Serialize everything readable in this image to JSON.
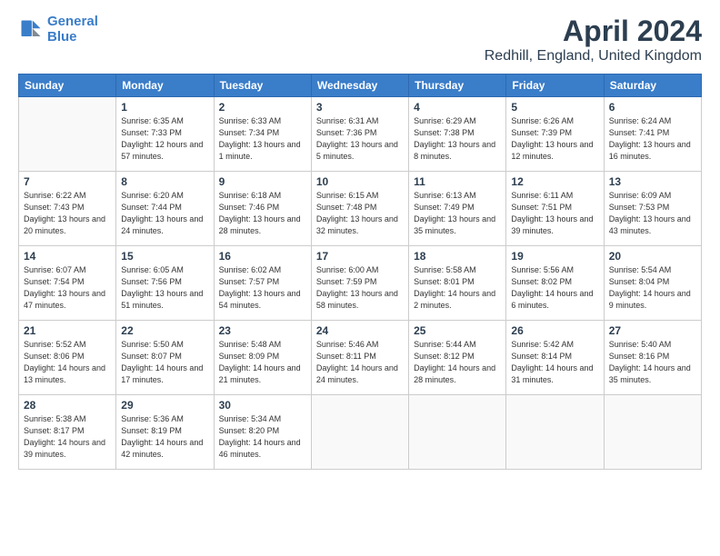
{
  "header": {
    "logo_line1": "General",
    "logo_line2": "Blue",
    "title": "April 2024",
    "subtitle": "Redhill, England, United Kingdom"
  },
  "days_of_week": [
    "Sunday",
    "Monday",
    "Tuesday",
    "Wednesday",
    "Thursday",
    "Friday",
    "Saturday"
  ],
  "weeks": [
    [
      {
        "num": "",
        "sunrise": "",
        "sunset": "",
        "daylight": ""
      },
      {
        "num": "1",
        "sunrise": "Sunrise: 6:35 AM",
        "sunset": "Sunset: 7:33 PM",
        "daylight": "Daylight: 12 hours and 57 minutes."
      },
      {
        "num": "2",
        "sunrise": "Sunrise: 6:33 AM",
        "sunset": "Sunset: 7:34 PM",
        "daylight": "Daylight: 13 hours and 1 minute."
      },
      {
        "num": "3",
        "sunrise": "Sunrise: 6:31 AM",
        "sunset": "Sunset: 7:36 PM",
        "daylight": "Daylight: 13 hours and 5 minutes."
      },
      {
        "num": "4",
        "sunrise": "Sunrise: 6:29 AM",
        "sunset": "Sunset: 7:38 PM",
        "daylight": "Daylight: 13 hours and 8 minutes."
      },
      {
        "num": "5",
        "sunrise": "Sunrise: 6:26 AM",
        "sunset": "Sunset: 7:39 PM",
        "daylight": "Daylight: 13 hours and 12 minutes."
      },
      {
        "num": "6",
        "sunrise": "Sunrise: 6:24 AM",
        "sunset": "Sunset: 7:41 PM",
        "daylight": "Daylight: 13 hours and 16 minutes."
      }
    ],
    [
      {
        "num": "7",
        "sunrise": "Sunrise: 6:22 AM",
        "sunset": "Sunset: 7:43 PM",
        "daylight": "Daylight: 13 hours and 20 minutes."
      },
      {
        "num": "8",
        "sunrise": "Sunrise: 6:20 AM",
        "sunset": "Sunset: 7:44 PM",
        "daylight": "Daylight: 13 hours and 24 minutes."
      },
      {
        "num": "9",
        "sunrise": "Sunrise: 6:18 AM",
        "sunset": "Sunset: 7:46 PM",
        "daylight": "Daylight: 13 hours and 28 minutes."
      },
      {
        "num": "10",
        "sunrise": "Sunrise: 6:15 AM",
        "sunset": "Sunset: 7:48 PM",
        "daylight": "Daylight: 13 hours and 32 minutes."
      },
      {
        "num": "11",
        "sunrise": "Sunrise: 6:13 AM",
        "sunset": "Sunset: 7:49 PM",
        "daylight": "Daylight: 13 hours and 35 minutes."
      },
      {
        "num": "12",
        "sunrise": "Sunrise: 6:11 AM",
        "sunset": "Sunset: 7:51 PM",
        "daylight": "Daylight: 13 hours and 39 minutes."
      },
      {
        "num": "13",
        "sunrise": "Sunrise: 6:09 AM",
        "sunset": "Sunset: 7:53 PM",
        "daylight": "Daylight: 13 hours and 43 minutes."
      }
    ],
    [
      {
        "num": "14",
        "sunrise": "Sunrise: 6:07 AM",
        "sunset": "Sunset: 7:54 PM",
        "daylight": "Daylight: 13 hours and 47 minutes."
      },
      {
        "num": "15",
        "sunrise": "Sunrise: 6:05 AM",
        "sunset": "Sunset: 7:56 PM",
        "daylight": "Daylight: 13 hours and 51 minutes."
      },
      {
        "num": "16",
        "sunrise": "Sunrise: 6:02 AM",
        "sunset": "Sunset: 7:57 PM",
        "daylight": "Daylight: 13 hours and 54 minutes."
      },
      {
        "num": "17",
        "sunrise": "Sunrise: 6:00 AM",
        "sunset": "Sunset: 7:59 PM",
        "daylight": "Daylight: 13 hours and 58 minutes."
      },
      {
        "num": "18",
        "sunrise": "Sunrise: 5:58 AM",
        "sunset": "Sunset: 8:01 PM",
        "daylight": "Daylight: 14 hours and 2 minutes."
      },
      {
        "num": "19",
        "sunrise": "Sunrise: 5:56 AM",
        "sunset": "Sunset: 8:02 PM",
        "daylight": "Daylight: 14 hours and 6 minutes."
      },
      {
        "num": "20",
        "sunrise": "Sunrise: 5:54 AM",
        "sunset": "Sunset: 8:04 PM",
        "daylight": "Daylight: 14 hours and 9 minutes."
      }
    ],
    [
      {
        "num": "21",
        "sunrise": "Sunrise: 5:52 AM",
        "sunset": "Sunset: 8:06 PM",
        "daylight": "Daylight: 14 hours and 13 minutes."
      },
      {
        "num": "22",
        "sunrise": "Sunrise: 5:50 AM",
        "sunset": "Sunset: 8:07 PM",
        "daylight": "Daylight: 14 hours and 17 minutes."
      },
      {
        "num": "23",
        "sunrise": "Sunrise: 5:48 AM",
        "sunset": "Sunset: 8:09 PM",
        "daylight": "Daylight: 14 hours and 21 minutes."
      },
      {
        "num": "24",
        "sunrise": "Sunrise: 5:46 AM",
        "sunset": "Sunset: 8:11 PM",
        "daylight": "Daylight: 14 hours and 24 minutes."
      },
      {
        "num": "25",
        "sunrise": "Sunrise: 5:44 AM",
        "sunset": "Sunset: 8:12 PM",
        "daylight": "Daylight: 14 hours and 28 minutes."
      },
      {
        "num": "26",
        "sunrise": "Sunrise: 5:42 AM",
        "sunset": "Sunset: 8:14 PM",
        "daylight": "Daylight: 14 hours and 31 minutes."
      },
      {
        "num": "27",
        "sunrise": "Sunrise: 5:40 AM",
        "sunset": "Sunset: 8:16 PM",
        "daylight": "Daylight: 14 hours and 35 minutes."
      }
    ],
    [
      {
        "num": "28",
        "sunrise": "Sunrise: 5:38 AM",
        "sunset": "Sunset: 8:17 PM",
        "daylight": "Daylight: 14 hours and 39 minutes."
      },
      {
        "num": "29",
        "sunrise": "Sunrise: 5:36 AM",
        "sunset": "Sunset: 8:19 PM",
        "daylight": "Daylight: 14 hours and 42 minutes."
      },
      {
        "num": "30",
        "sunrise": "Sunrise: 5:34 AM",
        "sunset": "Sunset: 8:20 PM",
        "daylight": "Daylight: 14 hours and 46 minutes."
      },
      {
        "num": "",
        "sunrise": "",
        "sunset": "",
        "daylight": ""
      },
      {
        "num": "",
        "sunrise": "",
        "sunset": "",
        "daylight": ""
      },
      {
        "num": "",
        "sunrise": "",
        "sunset": "",
        "daylight": ""
      },
      {
        "num": "",
        "sunrise": "",
        "sunset": "",
        "daylight": ""
      }
    ]
  ]
}
